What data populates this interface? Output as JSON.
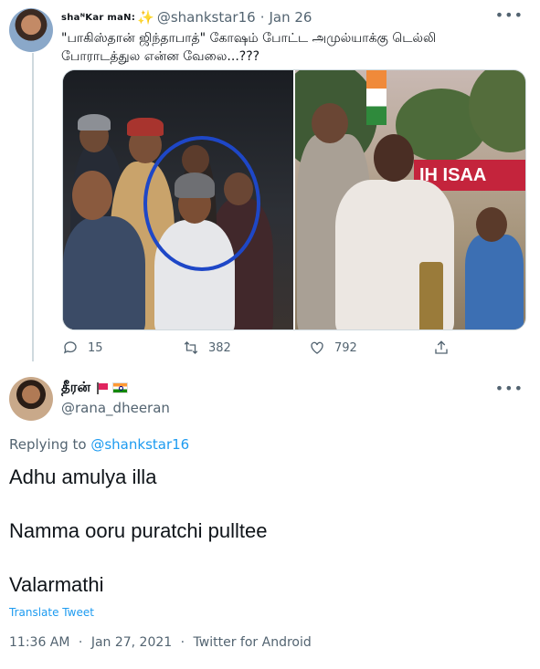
{
  "parent_tweet": {
    "display_name": "shaᴺKar maN:",
    "name_emoji": "sparkles-emoji",
    "handle": "@shankstar16",
    "separator": "·",
    "date": "Jan 26",
    "text": "\"பாகிஸ்தான் ஜிந்தாபாத்\" கோஷம் போட்ட அமுல்யாக்கு டெல்லி போராடத்துல என்ன வேலை...???",
    "right_photo_banner": "IH ISAA",
    "actions": {
      "reply_count": "15",
      "retweet_count": "382",
      "like_count": "792"
    }
  },
  "reply_tweet": {
    "display_name": "தீரன்",
    "handle": "@rana_dheeran",
    "replying_to_label": "Replying to",
    "replying_to_handle": "@shankstar16",
    "lines": [
      "Adhu amulya illa",
      "Namma ooru puratchi pulltee",
      "Valarmathi"
    ],
    "translate_label": "Translate Tweet",
    "time": "11:36 AM",
    "dot": "·",
    "date": "Jan 27, 2021",
    "source": "Twitter for Android"
  },
  "colors": {
    "link_blue": "#1d9bf0",
    "muted_gray": "#536471",
    "text_dark": "#0f1419",
    "circle_annotation": "#1e47c7"
  }
}
